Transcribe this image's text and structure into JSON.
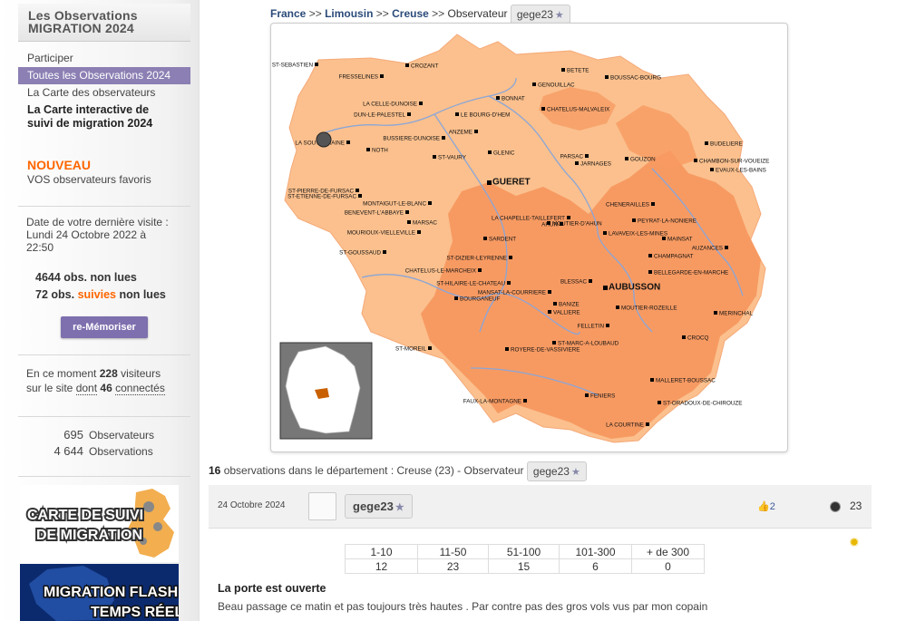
{
  "sidebar": {
    "header_line1": "Les Observations",
    "header_line2": "MIGRATION 2024",
    "menu": [
      {
        "label": "Participer"
      },
      {
        "label": "Toutes les Observations 2024"
      },
      {
        "label": "La Carte des observateurs"
      },
      {
        "label": "La Carte interactive de"
      },
      {
        "label": "suivi de migration 2024"
      }
    ],
    "nouveau_title": "NOUVEAU",
    "nouveau_sub": "VOS observateurs favoris",
    "last_visit_1": "Date de votre dernière visite :",
    "last_visit_2": "Lundi 24 Octobre 2022 à",
    "last_visit_3": "22:50",
    "unread_count": "4644",
    "unread_label": "obs. non lues",
    "followed_count": "72",
    "followed_mid": "obs.",
    "followed_word": "suivies",
    "followed_end": "non lues",
    "rememorise_button": "re-Mémoriser",
    "online_1": "En ce moment",
    "online_visitors": "228",
    "online_2": "visiteurs",
    "online_3": "sur le site",
    "online_4": "dont",
    "online_connected": "46",
    "online_5": "connectés",
    "observers_count": "695",
    "observers_label": "Observateurs",
    "observations_count": "4 644",
    "observations_label": "Observations",
    "banner1_l1": "CARTE DE SUIVI",
    "banner1_l2": "DE MIGRATION",
    "banner2_l1": "MIGRATION FLASH",
    "banner2_l2": "TEMPS RÉEL"
  },
  "breadcrumb": {
    "items": [
      "France",
      "Limousin",
      "Creuse"
    ],
    "sep": ">>",
    "last": "Observateur",
    "user": "gege23"
  },
  "map": {
    "land_color": "#fbc08d",
    "dark_color": "#f79a62",
    "river_color": "#8aa6d8",
    "towns": [
      {
        "name": "ST-SEBASTIEN"
      },
      {
        "name": "CROZANT"
      },
      {
        "name": "BETETE"
      },
      {
        "name": "FRESSELINES"
      },
      {
        "name": "GENOUILLAC"
      },
      {
        "name": "BOUSSAC-BOURG"
      },
      {
        "name": "BONNAT"
      },
      {
        "name": "LA CELLE-DUNOISE"
      },
      {
        "name": "CHATELUS-MALVALEIX"
      },
      {
        "name": "DUN-LE-PALESTEL"
      },
      {
        "name": "LE BOURG-D'HEM"
      },
      {
        "name": "ANZEME"
      },
      {
        "name": "LA SOUTERRAINE"
      },
      {
        "name": "BUSSIERE-DUNOISE"
      },
      {
        "name": "NOTH"
      },
      {
        "name": "GLENIC"
      },
      {
        "name": "ST-VAURY"
      },
      {
        "name": "PARSAC"
      },
      {
        "name": "JARNAGES"
      },
      {
        "name": "GOUZON"
      },
      {
        "name": "BUDELIERE"
      },
      {
        "name": "CHAMBON-SUR-VOUEIZE"
      },
      {
        "name": "EVAUX-LES-BAINS"
      },
      {
        "name": "GUERET"
      },
      {
        "name": "ST-PIERRE-DE-FURSAC"
      },
      {
        "name": "ST-ETIENNE-DE-FURSAC"
      },
      {
        "name": "MONTAIGUT-LE-BLANC"
      },
      {
        "name": "BENEVENT-L'ABBAYE"
      },
      {
        "name": "CHENERAILLES"
      },
      {
        "name": "LA CHAPELLE-TAILLEFERT"
      },
      {
        "name": "MOUTIER-D'AHUN"
      },
      {
        "name": "AHUN"
      },
      {
        "name": "PEYRAT-LA-NONIERE"
      },
      {
        "name": "MARSAC"
      },
      {
        "name": "LAVAVEIX-LES-MINES"
      },
      {
        "name": "MOURIOUX-VIELLEVILLE"
      },
      {
        "name": "MAINSAT"
      },
      {
        "name": "AUZANCES"
      },
      {
        "name": "SARDENT"
      },
      {
        "name": "CHAMPAGNAT"
      },
      {
        "name": "ST-GOUSSAUD"
      },
      {
        "name": "ST-DIZIER-LEYRENNE"
      },
      {
        "name": "BELLEGARDE-EN-MARCHE"
      },
      {
        "name": "CHATELUS-LE-MARCHEIX"
      },
      {
        "name": "ST-HILAIRE-LE-CHATEAU"
      },
      {
        "name": "BLESSAC"
      },
      {
        "name": "AUBUSSON"
      },
      {
        "name": "MANSAT-LA-COURRIERE"
      },
      {
        "name": "BOURGANEUF"
      },
      {
        "name": "BANIZE"
      },
      {
        "name": "MOUTIER-ROZEILLE"
      },
      {
        "name": "VALLIERE"
      },
      {
        "name": "MERINCHAL"
      },
      {
        "name": "FELLETIN"
      },
      {
        "name": "CROCQ"
      },
      {
        "name": "ST-MARC-A-LOUBAUD"
      },
      {
        "name": "ST-MOREIL"
      },
      {
        "name": "ROYERE-DE-VASSIVIERE"
      },
      {
        "name": "MALLERET-BOUSSAC"
      },
      {
        "name": "FENIERS"
      },
      {
        "name": "FAUX-LA-MONTAGNE"
      },
      {
        "name": "ST-ORADOUX-DE-CHIROUZE"
      },
      {
        "name": "LA COURTINE"
      }
    ]
  },
  "obs_summary": {
    "count": "16",
    "text": "observations dans le département : Creuse (23) - Observateur",
    "user": "gege23"
  },
  "observation": {
    "date": "24 Octobre 2024",
    "user": "gege23",
    "likes": "2",
    "dept": "23",
    "headers": [
      "1-10",
      "11-50",
      "51-100",
      "101-300",
      "+ de 300"
    ],
    "values": [
      "12",
      "23",
      "15",
      "6",
      "0"
    ],
    "title": "La porte est ouverte",
    "text": "Beau passage ce matin et pas toujours très hautes . Par contre pas des gros vols vus par mon copain"
  }
}
